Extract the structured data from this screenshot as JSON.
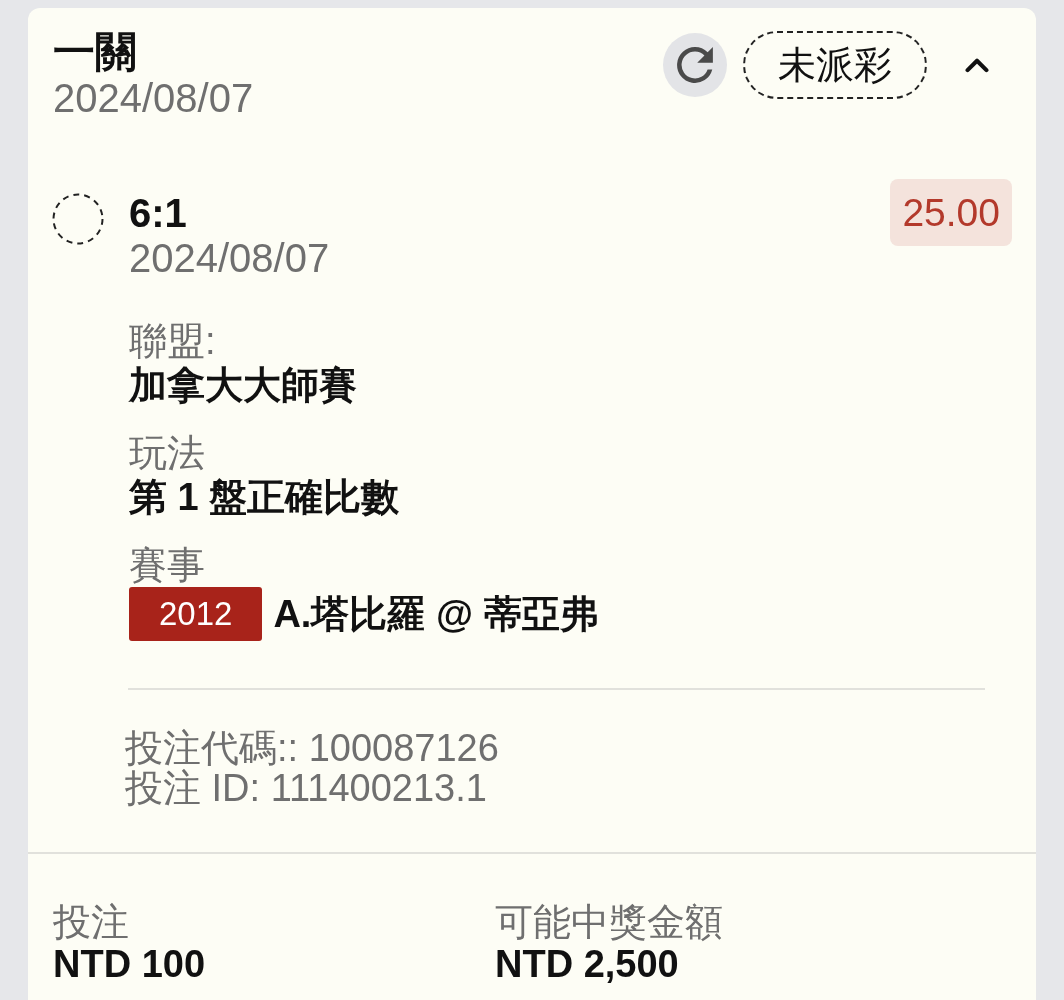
{
  "bet_card": {
    "title": "一關",
    "date": "2024/08/07",
    "status": "未派彩",
    "expanded": true
  },
  "selection": {
    "pick": "6:1",
    "date": "2024/08/07",
    "odds": "25.00"
  },
  "details": [
    {
      "label": "聯盟:",
      "value": "加拿大大師賽"
    },
    {
      "label": "玩法",
      "value": "第 1 盤正確比數"
    },
    {
      "label": "賽事",
      "event_code": "2012",
      "value": "A.塔比羅 @ 蒂亞弗"
    }
  ],
  "references": [
    "投注代碼:: 100087126",
    "投注 ID: 111400213.1"
  ],
  "summary": [
    {
      "label": "投注",
      "value": "NTD 100"
    },
    {
      "label": "可能中獎金額",
      "value": "NTD 2,500"
    }
  ]
}
